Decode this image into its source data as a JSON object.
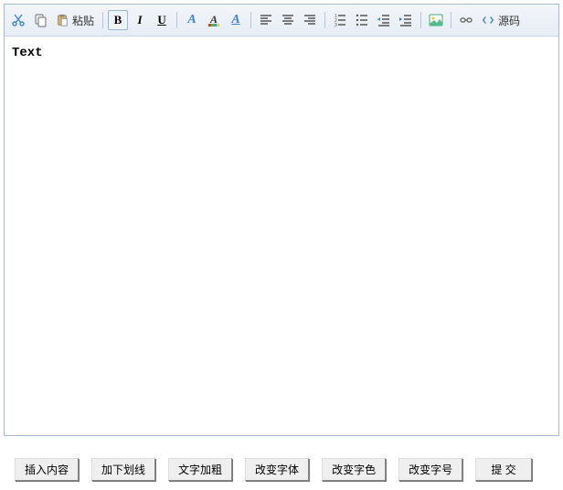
{
  "toolbar": {
    "paste_label": "粘贴",
    "source_label": "源码"
  },
  "editor": {
    "content": "Text"
  },
  "buttons": {
    "insert": "插入内容",
    "underline": "加下划线",
    "bold": "文字加粗",
    "font": "改变字体",
    "color": "改变字色",
    "size": "改变字号",
    "submit": "提 交"
  }
}
